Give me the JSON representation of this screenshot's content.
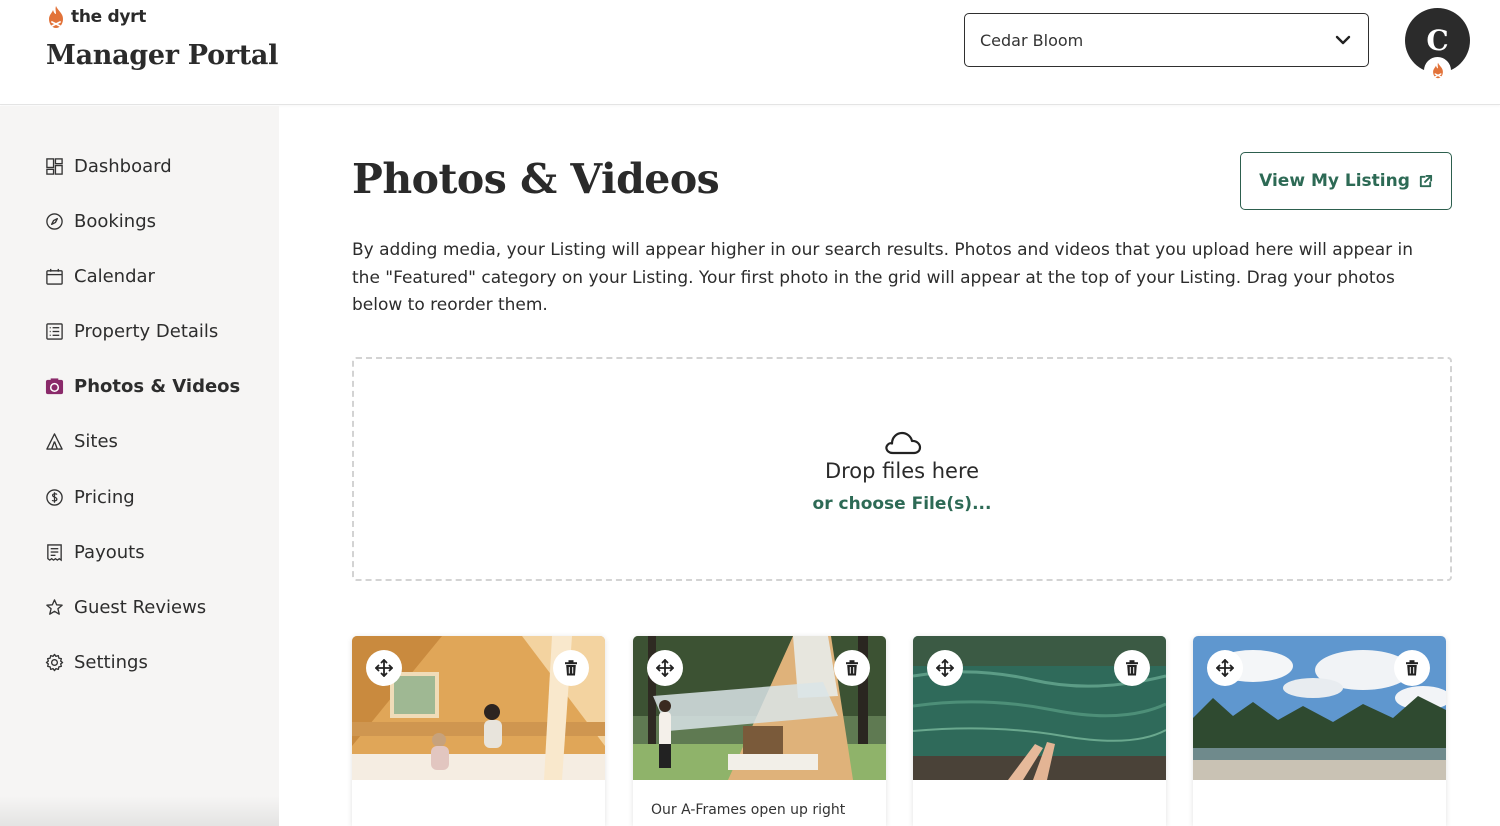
{
  "header": {
    "brand_name": "the dyrt",
    "portal_title": "Manager Portal",
    "campground_select": {
      "selected": "Cedar Bloom"
    },
    "avatar_initial": "C"
  },
  "sidebar": {
    "items": [
      {
        "label": "Dashboard",
        "icon": "dashboard-icon",
        "active": false
      },
      {
        "label": "Bookings",
        "icon": "compass-icon",
        "active": false
      },
      {
        "label": "Calendar",
        "icon": "calendar-icon",
        "active": false
      },
      {
        "label": "Property Details",
        "icon": "list-icon",
        "active": false
      },
      {
        "label": "Photos & Videos",
        "icon": "camera-icon",
        "active": true
      },
      {
        "label": "Sites",
        "icon": "tent-icon",
        "active": false
      },
      {
        "label": "Pricing",
        "icon": "dollar-circle-icon",
        "active": false
      },
      {
        "label": "Payouts",
        "icon": "receipt-icon",
        "active": false
      },
      {
        "label": "Guest Reviews",
        "icon": "star-icon",
        "active": false
      },
      {
        "label": "Settings",
        "icon": "gear-icon",
        "active": false
      }
    ]
  },
  "main": {
    "title": "Photos & Videos",
    "view_listing_label": "View My Listing",
    "intro": "By adding media, your Listing will appear higher in our search results. Photos and videos that you upload here will appear in the \"Featured\" category on your Listing. Your first photo in the grid will appear at the top of your Listing. Drag your photos below to reorder them.",
    "dropzone": {
      "title": "Drop files here",
      "choose_label": "or choose File(s)..."
    },
    "photos": [
      {
        "caption": "",
        "scene": "a-frame interior with two women"
      },
      {
        "caption": "Our A-Frames open up right",
        "scene": "a-frame cabin exterior"
      },
      {
        "caption": "",
        "scene": "feet by clear river water"
      },
      {
        "caption": "",
        "scene": "river bank with trees and clouds"
      }
    ]
  },
  "colors": {
    "brand_orange": "#e2733a",
    "accent_green": "#2d6a55",
    "active_icon": "#8a2a6a",
    "sidebar_bg": "#f6f5f4"
  }
}
